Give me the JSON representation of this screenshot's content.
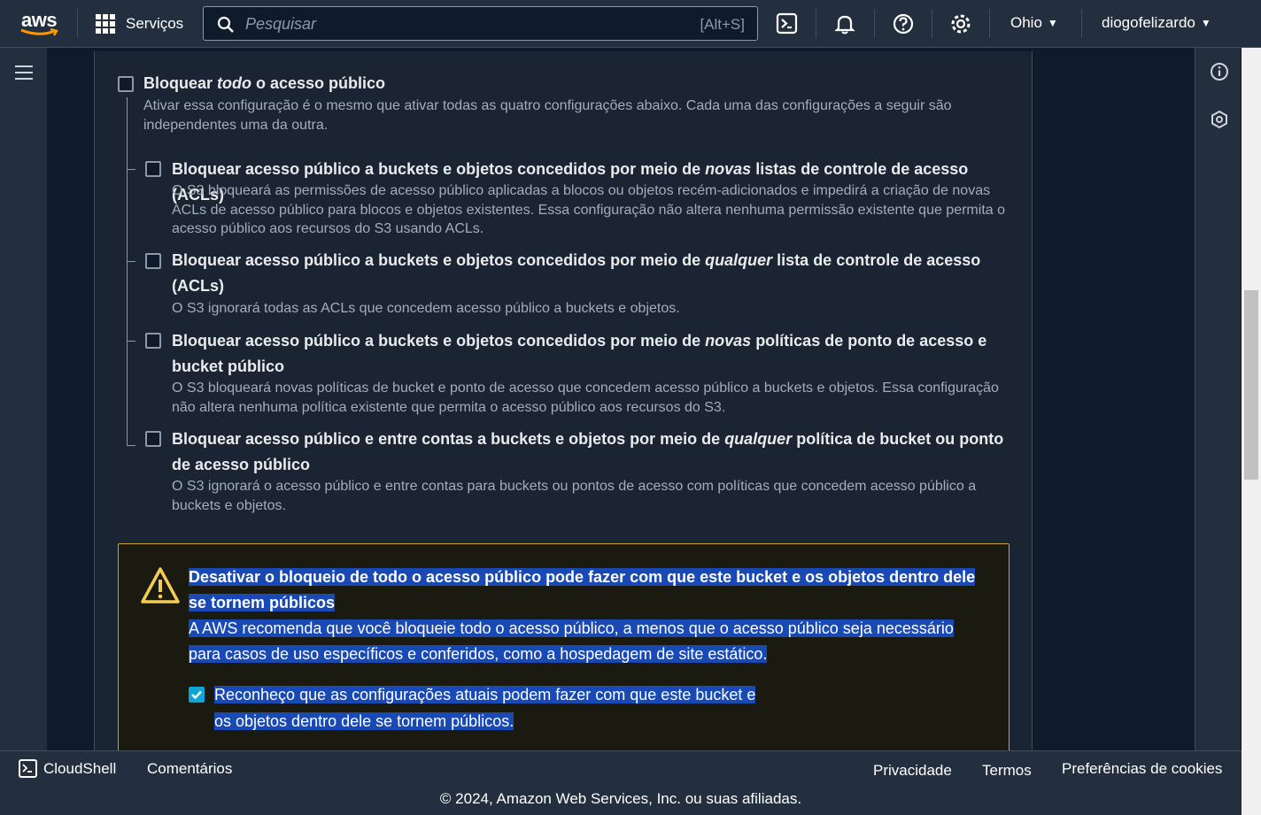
{
  "topnav": {
    "logo": "aws",
    "services_label": "Serviços",
    "search_placeholder": "Pesquisar",
    "search_shortcut": "[Alt+S]",
    "region": "Ohio",
    "user": "diogofelizardo",
    "icons": [
      "cloudshell-icon",
      "bell-icon",
      "help-icon",
      "gear-icon"
    ]
  },
  "block_all": {
    "title_pre": "Bloquear ",
    "title_em": "todo",
    "title_post": " o acesso público",
    "desc": "Ativar essa configuração é o mesmo que ativar todas as quatro configurações abaixo. Cada uma das configurações a seguir são independentes uma da outra."
  },
  "options": [
    {
      "title_pre": "Bloquear acesso público a buckets e objetos concedidos por meio de ",
      "title_em": "novas",
      "title_post": " listas de controle de acesso (ACLs)",
      "desc": "O S3 bloqueará as permissões de acesso público aplicadas a blocos ou objetos recém-adicionados e impedirá a criação de novas ACLs de acesso público para blocos e objetos existentes. Essa configuração não altera nenhuma permissão existente que permita o acesso público aos recursos do S3 usando ACLs."
    },
    {
      "title_pre": "Bloquear acesso público a buckets e objetos concedidos por meio de ",
      "title_em": "qualquer",
      "title_post": " lista de controle de acesso (ACLs)",
      "desc": "O S3 ignorará todas as ACLs que concedem acesso público a buckets e objetos."
    },
    {
      "title_pre": "Bloquear acesso público a buckets e objetos concedidos por meio de ",
      "title_em": "novas",
      "title_post": " políticas de ponto de acesso e bucket público",
      "desc": "O S3 bloqueará novas políticas de bucket e ponto de acesso que concedem acesso público a buckets e objetos. Essa configuração não altera nenhuma política existente que permita o acesso público aos recursos do S3."
    },
    {
      "title_pre": "Bloquear acesso público e entre contas a buckets e objetos por meio de ",
      "title_em": "qualquer",
      "title_post": " política de bucket ou ponto de acesso público",
      "desc": "O S3 ignorará o acesso público e entre contas para buckets ou pontos de acesso com políticas que concedem acesso público a buckets e objetos."
    }
  ],
  "warning": {
    "title": "Desativar o bloqueio de todo o acesso público pode fazer com que este bucket e os objetos dentro dele se tornem públicos",
    "text": "A AWS recomenda que você bloqueie todo o acesso público, a menos que o acesso público seja necessário para casos de uso específicos e conferidos, como a hospedagem de site estático.",
    "ack_line1": "Reconheço que as configurações atuais podem fazer com que este bucket e",
    "ack_line2": "os objetos dentro dele se tornem públicos."
  },
  "footer": {
    "cloudshell": "CloudShell",
    "comments": "Comentários",
    "privacy": "Privacidade",
    "terms": "Termos",
    "cookies": "Preferências de cookies",
    "copyright": "© 2024, Amazon Web Services, Inc. ou suas afiliadas."
  }
}
